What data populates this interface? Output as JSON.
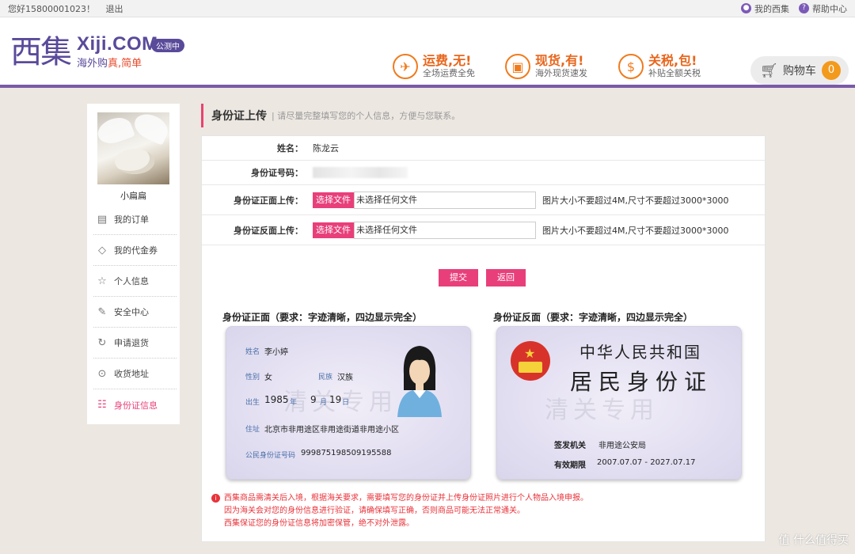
{
  "topbar": {
    "greeting": "您好15800001023！",
    "logout": "退出",
    "my_xiji": "我的西集",
    "help": "帮助中心"
  },
  "header": {
    "logo_cn": "西集",
    "logo_en": "Xiji.COM",
    "slogan_a": "海外购",
    "slogan_b": "真,简单",
    "badge": "公测中",
    "promos": [
      {
        "title": "运费,无!",
        "sub": "全场运费全免"
      },
      {
        "title": "现货,有!",
        "sub": "海外现货速发"
      },
      {
        "title": "关税,包!",
        "sub": "补贴全额关税"
      }
    ],
    "cart": {
      "label": "购物车",
      "count": "0"
    }
  },
  "sidebar": {
    "username": "小扁扁",
    "items": [
      {
        "label": "我的订单",
        "icon": "order-icon"
      },
      {
        "label": "我的代金券",
        "icon": "coupon-icon"
      },
      {
        "label": "个人信息",
        "icon": "star-icon"
      },
      {
        "label": "安全中心",
        "icon": "edit-icon"
      },
      {
        "label": "申请退货",
        "icon": "refresh-icon"
      },
      {
        "label": "收货地址",
        "icon": "location-icon"
      },
      {
        "label": "身份证信息",
        "icon": "id-card-icon",
        "active": true
      }
    ]
  },
  "main": {
    "title": "身份证上传",
    "desc": "| 请尽量完整填写您的个人信息，方便与您联系。",
    "form": {
      "name_label": "姓名：",
      "name_value": "陈龙云",
      "id_label": "身份证号码：",
      "front_label": "身份证正面上传：",
      "back_label": "身份证反面上传：",
      "choose_file": "选择文件",
      "no_file": "未选择任何文件",
      "hint": "图片大小不要超过4M,尺寸不要超过3000*3000"
    },
    "submit": "提交",
    "back": "返回",
    "front_card_title": "身份证正面（要求：字迹清晰，四边显示完全）",
    "back_card_title": "身份证反面（要求：字迹清晰，四边显示完全）",
    "front_card": {
      "name_k": "姓名",
      "name_v": "李小婷",
      "sex_k": "性别",
      "sex_v": "女",
      "nation_k": "民族",
      "nation_v": "汉族",
      "birth_k": "出生",
      "birth_y": "1985",
      "birth_y_unit": "年",
      "birth_m": "9",
      "birth_m_unit": "月",
      "birth_d": "19",
      "birth_d_unit": "日",
      "addr_k": "住址",
      "addr_v": "北京市非用途区非用途街道非用途小区",
      "idno_k": "公民身份证号码",
      "idno_v": "999875198509195588",
      "watermark": "清关专用"
    },
    "back_card": {
      "country": "中华人民共和国",
      "doc": "居民身份证",
      "issuer_k": "签发机关",
      "issuer_v": "非用途公安局",
      "valid_k": "有效期限",
      "valid_v": "2007.07.07 - 2027.07.17",
      "watermark": "清关专用"
    },
    "notes": [
      "西集商品需清关后入境，根据海关要求，需要填写您的身份证并上传身份证照片进行个人物品入境申报。",
      "因为海关会对您的身份信息进行验证，请确保填写正确，否则商品可能无法正常通关。",
      "西集保证您的身份证信息将加密保管，绝不对外泄露。"
    ]
  },
  "watermark_site": "值 什么值得买",
  "colors": {
    "brand": "#5a4a9a",
    "accent": "#e83f7a",
    "orange": "#f07b1c"
  }
}
